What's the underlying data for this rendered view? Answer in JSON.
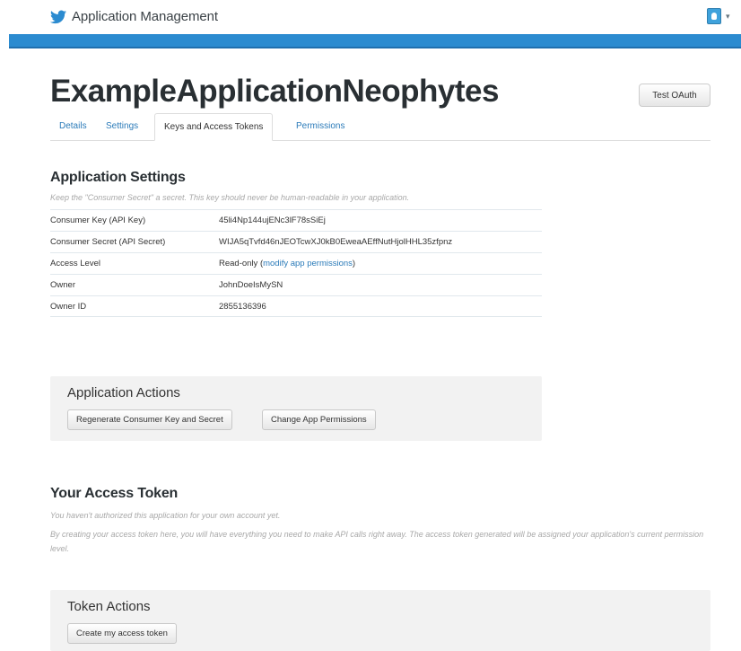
{
  "header": {
    "app_title": "Application Management",
    "colors": {
      "brand_blue": "#2b8bd0",
      "link_blue": "#2b7bb9"
    }
  },
  "app": {
    "name": "ExampleApplicationNeophytes",
    "test_oauth_label": "Test OAuth"
  },
  "tabs": [
    {
      "label": "Details",
      "active": false
    },
    {
      "label": "Settings",
      "active": false
    },
    {
      "label": "Keys and Access Tokens",
      "active": true
    },
    {
      "label": "Permissions",
      "active": false
    }
  ],
  "application_settings": {
    "title": "Application Settings",
    "note": "Keep the \"Consumer Secret\" a secret. This key should never be human-readable in your application.",
    "rows": [
      {
        "key": "Consumer Key (API Key)",
        "value": "45li4Np144ujENc3lF78sSiEj"
      },
      {
        "key": "Consumer Secret (API Secret)",
        "value": "WIJA5qTvfd46nJEOTcwXJ0kB0EweaAEffNutHjolHHL35zfpnz"
      },
      {
        "key": "Access Level",
        "value_prefix": "Read-only (",
        "value_link": "modify app permissions",
        "value_suffix": ")"
      },
      {
        "key": "Owner",
        "value": "JohnDoeIsMySN"
      },
      {
        "key": "Owner ID",
        "value": "2855136396"
      }
    ]
  },
  "application_actions": {
    "title": "Application Actions",
    "regenerate_label": "Regenerate Consumer Key and Secret",
    "change_permissions_label": "Change App Permissions"
  },
  "access_token": {
    "title": "Your Access Token",
    "note1": "You haven't authorized this application for your own account yet.",
    "note2": "By creating your access token here, you will have everything you need to make API calls right away. The access token generated will be assigned your application's current permission level."
  },
  "token_actions": {
    "title": "Token Actions",
    "create_label": "Create my access token"
  }
}
